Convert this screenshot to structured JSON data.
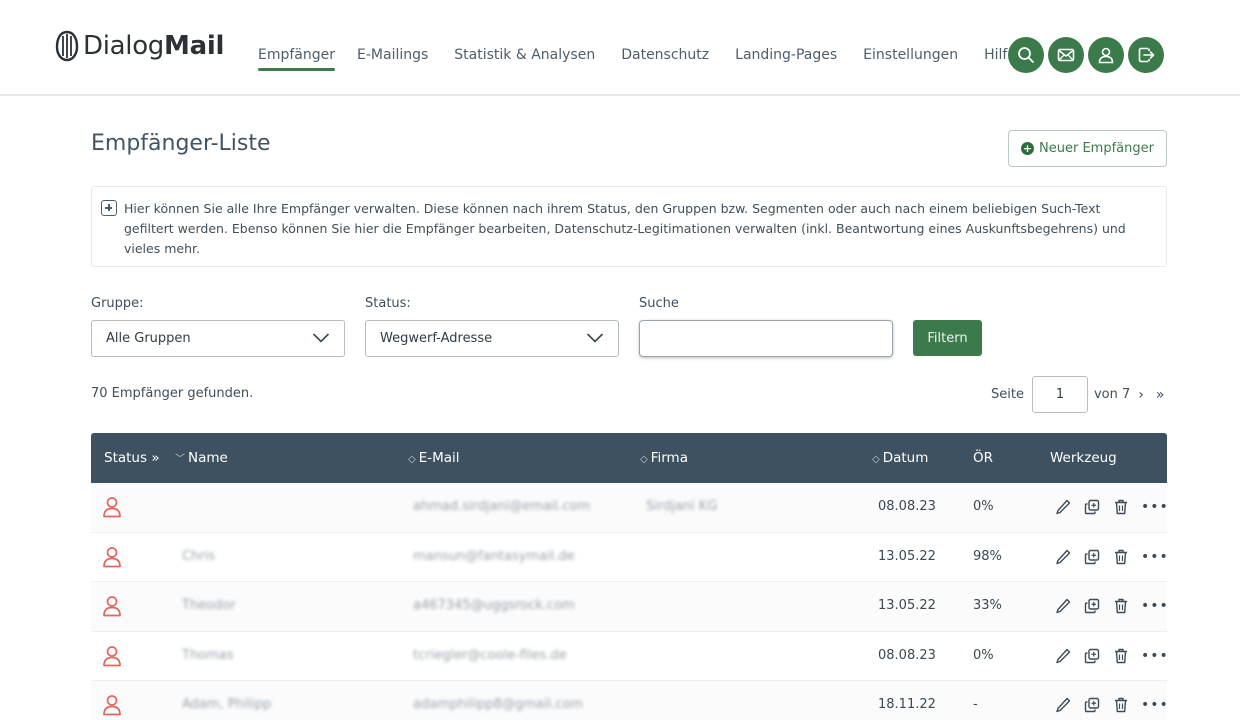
{
  "brand": {
    "name_regular": "Dialog",
    "name_bold": "Mail"
  },
  "nav": [
    {
      "label": "Empfänger",
      "active": true
    },
    {
      "label": "E-Mailings"
    },
    {
      "label": "Statistik & Analysen"
    },
    {
      "label": "Datenschutz"
    },
    {
      "label": "Landing-Pages"
    },
    {
      "label": "Einstellungen"
    },
    {
      "label": "Hilfe"
    }
  ],
  "header_icons": [
    "search-icon",
    "mail-icon",
    "user-icon",
    "logout-icon"
  ],
  "colors": {
    "brand_green": "#3a7a4b",
    "table_header": "#3d5160",
    "status_red": "#e0665e"
  },
  "page": {
    "title": "Empfänger-Liste",
    "new_button": "Neuer Empfänger",
    "info": "Hier können Sie alle Ihre Empfänger verwalten. Diese können nach ihrem Status, den Gruppen bzw. Segmenten oder auch nach einem beliebigen Such-Text gefiltert werden. Ebenso können Sie hier die Empfänger bearbeiten, Datenschutz-Legitimationen verwalten (inkl. Beantwortung eines Auskunftsbegehrens) und vieles mehr."
  },
  "filters": {
    "group_label": "Gruppe:",
    "group_value": "Alle Gruppen",
    "status_label": "Status:",
    "status_value": "Wegwerf-Adresse",
    "search_label": "Suche",
    "search_value": "",
    "filter_button": "Filtern"
  },
  "results": {
    "count_text": "70 Empfänger gefunden.",
    "page_label": "Seite",
    "page_current": "1",
    "page_total": "von 7",
    "next": "›",
    "last": "»"
  },
  "table": {
    "columns": {
      "status": "Status",
      "status_toggle": "»",
      "name": "Name",
      "email": "E-Mail",
      "company": "Firma",
      "date": "Datum",
      "open_rate": "ÖR",
      "tools": "Werkzeug"
    },
    "rows": [
      {
        "name": "",
        "email": "ahmad.sirdjani@email.com",
        "company": "Sirdjani KG",
        "date": "08.08.23",
        "open_rate": "0%"
      },
      {
        "name": "Chris",
        "email": "mansun@fantasymail.de",
        "company": "",
        "date": "13.05.22",
        "open_rate": "98%"
      },
      {
        "name": "Theodor",
        "email": "a467345@uggsrock.com",
        "company": "",
        "date": "13.05.22",
        "open_rate": "33%"
      },
      {
        "name": "Thomas",
        "email": "tcriegler@coole-files.de",
        "company": "",
        "date": "08.08.23",
        "open_rate": "0%"
      },
      {
        "name": "Adam, Philipp",
        "email": "adamphilipp8@gmail.com",
        "company": "",
        "date": "18.11.22",
        "open_rate": "-"
      }
    ]
  }
}
